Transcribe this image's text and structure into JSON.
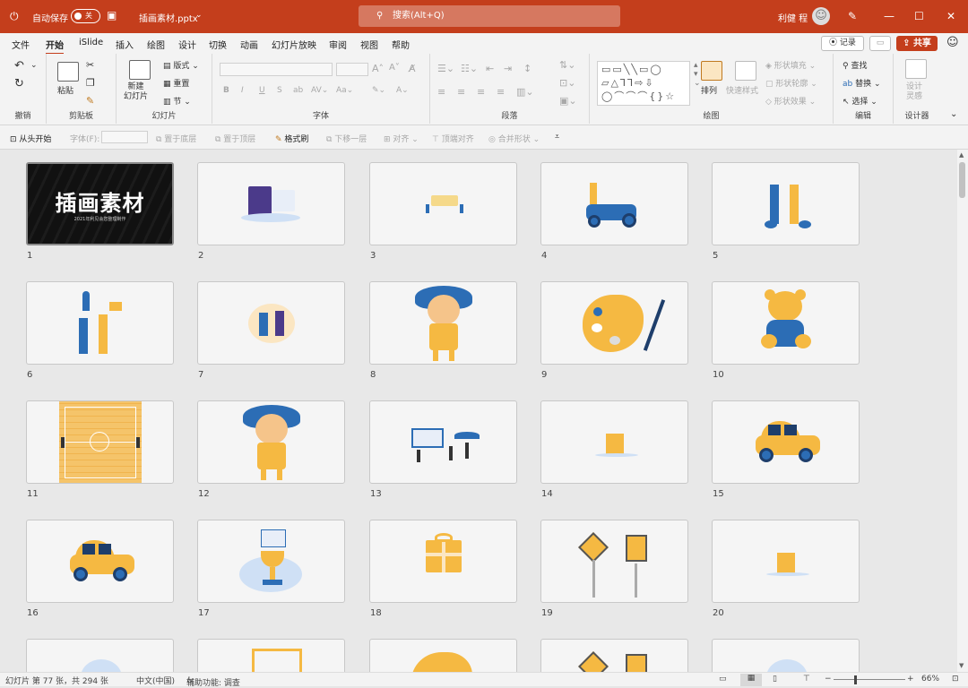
{
  "titlebar": {
    "autosave_label": "自动保存",
    "autosave_state": "关",
    "filename": "插画素材.pptx",
    "search_placeholder": "搜索(Alt+Q)",
    "user_name": "利健 程"
  },
  "menu": {
    "tabs": [
      "文件",
      "开始",
      "iSlide",
      "插入",
      "绘图",
      "设计",
      "切换",
      "动画",
      "幻灯片放映",
      "审阅",
      "视图",
      "帮助"
    ],
    "record": "记录",
    "share": "共享"
  },
  "ribbon": {
    "groups": {
      "undo": "撤销",
      "clipboard": "剪贴板",
      "slides": "幻灯片",
      "font": "字体",
      "paragraph": "段落",
      "drawing": "绘图",
      "editing": "编辑",
      "designer": "设计器"
    },
    "paste": "粘贴",
    "new_slide": "新建\n幻灯片",
    "layout": "版式",
    "reset": "重置",
    "section": "节",
    "arrange": "排列",
    "quick_styles": "快速样式",
    "shape_fill": "形状填充",
    "shape_outline": "形状轮廓",
    "shape_effects": "形状效果",
    "find": "查找",
    "replace": "替换",
    "select": "选择",
    "design_ideas": "设计\n灵感"
  },
  "qab": {
    "from_start": "从头开始",
    "font_label": "字体(F):",
    "send_back": "置于底层",
    "bring_front": "置于顶层",
    "format_painter": "格式刷",
    "send_backward": "下移一层",
    "align": "对齐",
    "align_top": "顶端对齐",
    "merge": "合并形状"
  },
  "slides": [
    {
      "n": "1"
    },
    {
      "n": "2"
    },
    {
      "n": "3"
    },
    {
      "n": "4"
    },
    {
      "n": "5"
    },
    {
      "n": "6"
    },
    {
      "n": "7"
    },
    {
      "n": "8"
    },
    {
      "n": "9"
    },
    {
      "n": "10"
    },
    {
      "n": "11"
    },
    {
      "n": "12"
    },
    {
      "n": "13"
    },
    {
      "n": "14"
    },
    {
      "n": "15"
    },
    {
      "n": "16"
    },
    {
      "n": "17"
    },
    {
      "n": "18"
    },
    {
      "n": "19"
    },
    {
      "n": "20"
    }
  ],
  "slide1": {
    "title": "插画素材",
    "subtitle": "2021年利见会您整理制作"
  },
  "status": {
    "slide_info": "幻灯片 第 77 张，共 294 张",
    "language": "中文(中国)",
    "accessibility": "辅助功能: 调查",
    "zoom": "66%"
  },
  "colors": {
    "accent": "#c43e1c",
    "yellow": "#f5b942",
    "blue": "#2c6db5"
  }
}
